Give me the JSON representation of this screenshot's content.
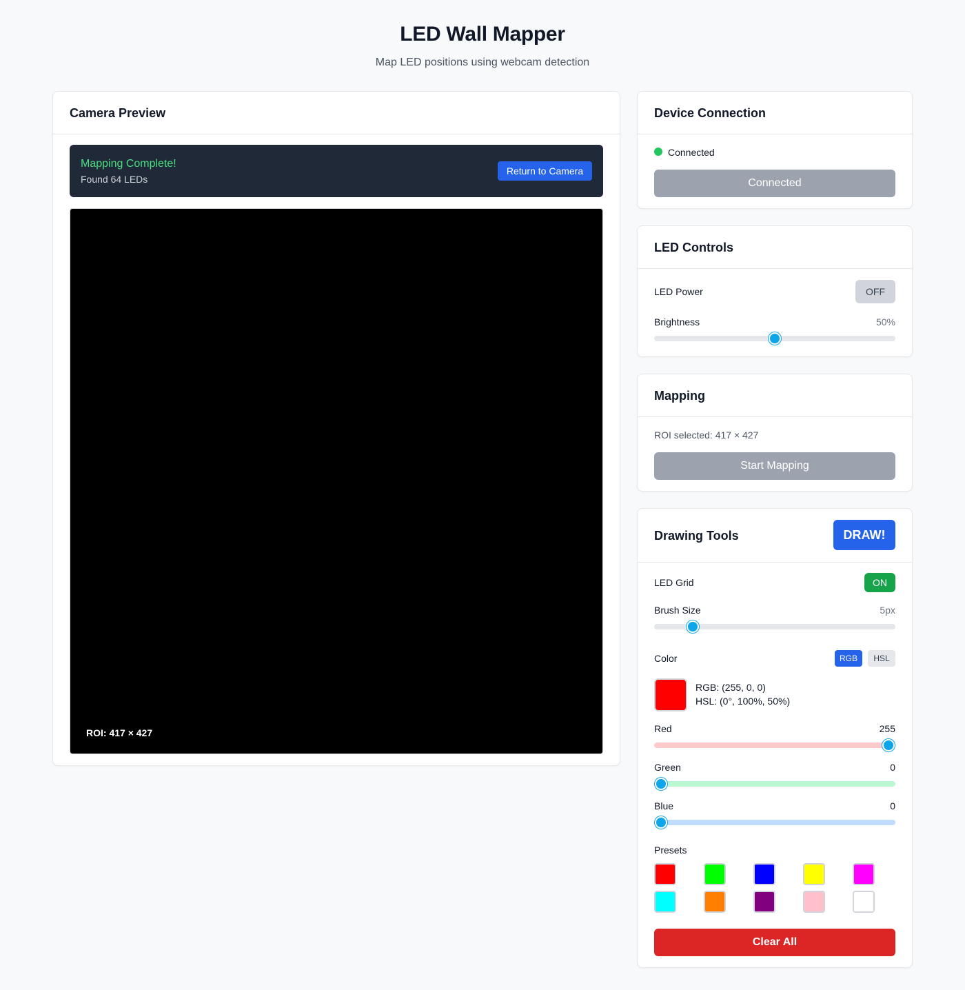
{
  "header": {
    "title": "LED Wall Mapper",
    "subtitle": "Map LED positions using webcam detection"
  },
  "camera": {
    "title": "Camera Preview",
    "banner_title": "Mapping Complete!",
    "banner_sub": "Found 64 LEDs",
    "return_label": "Return to Camera",
    "roi_label": "ROI: 417 × 427"
  },
  "device": {
    "title": "Device Connection",
    "status": "Connected",
    "status_color": "#22c55e",
    "button_label": "Connected"
  },
  "led_controls": {
    "title": "LED Controls",
    "power_label": "LED Power",
    "power_state": "OFF",
    "brightness_label": "Brightness",
    "brightness_value": "50%",
    "brightness_fraction": 0.5
  },
  "mapping": {
    "title": "Mapping",
    "roi_text": "ROI selected: 417 × 427",
    "button_label": "Start Mapping"
  },
  "drawing": {
    "title": "Drawing Tools",
    "draw_label": "DRAW!",
    "grid_label": "LED Grid",
    "grid_state": "ON",
    "brush_label": "Brush Size",
    "brush_value": "5px",
    "brush_fraction": 0.14,
    "color_label": "Color",
    "mode_rgb": "RGB",
    "mode_hsl": "HSL",
    "current_color": "#ff0000",
    "rgb_text": "RGB: (255, 0, 0)",
    "hsl_text": "HSL: (0°, 100%, 50%)",
    "red_label": "Red",
    "red_value": "255",
    "green_label": "Green",
    "green_value": "0",
    "blue_label": "Blue",
    "blue_value": "0",
    "presets_label": "Presets",
    "presets": [
      "#ff0000",
      "#00ff00",
      "#0000ff",
      "#ffff00",
      "#ff00ff",
      "#00ffff",
      "#ff8000",
      "#800080",
      "#ffc0cb",
      "#ffffff"
    ],
    "clear_label": "Clear All"
  }
}
